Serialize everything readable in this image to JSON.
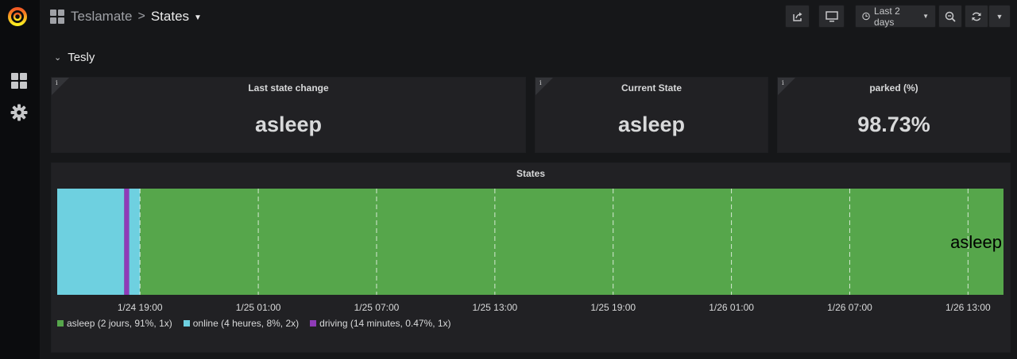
{
  "navbar": {
    "folder": "Teslamate",
    "separator": ">",
    "dashboard_title": "States",
    "time_range": "Last 2 days"
  },
  "row": {
    "title": "Tesly"
  },
  "panels": {
    "last_state_change": {
      "title": "Last state change",
      "value": "asleep"
    },
    "current_state": {
      "title": "Current State",
      "value": "asleep"
    },
    "parked": {
      "title": "parked (%)",
      "value": "98.73%"
    }
  },
  "info_glyph": "i",
  "colors": {
    "asleep": "#56a64b",
    "online": "#6ed0e0",
    "driving": "#8f3bb8",
    "background": "#161719",
    "panel": "#212124"
  },
  "chart_data": {
    "type": "state-timeline",
    "title": "States",
    "x_ticks": [
      "1/24 19:00",
      "1/25 01:00",
      "1/25 07:00",
      "1/25 13:00",
      "1/25 19:00",
      "1/26 01:00",
      "1/26 07:00",
      "1/26 13:00"
    ],
    "x_range_hours": [
      0,
      48
    ],
    "tick_start_hour": 4.2,
    "tick_interval_hours": 6,
    "segments": [
      {
        "state": "online",
        "start_hour": 0,
        "end_hour": 3.4
      },
      {
        "state": "driving",
        "start_hour": 3.4,
        "end_hour": 3.65
      },
      {
        "state": "online",
        "start_hour": 3.65,
        "end_hour": 4.2
      },
      {
        "state": "asleep",
        "start_hour": 4.2,
        "end_hour": 48
      }
    ],
    "value_label": "asleep",
    "legend": [
      {
        "state": "asleep",
        "label": "asleep (2 jours, 91%, 1x)"
      },
      {
        "state": "online",
        "label": "online (4 heures, 8%, 2x)"
      },
      {
        "state": "driving",
        "label": "driving (14 minutes, 0.47%, 1x)"
      }
    ]
  }
}
